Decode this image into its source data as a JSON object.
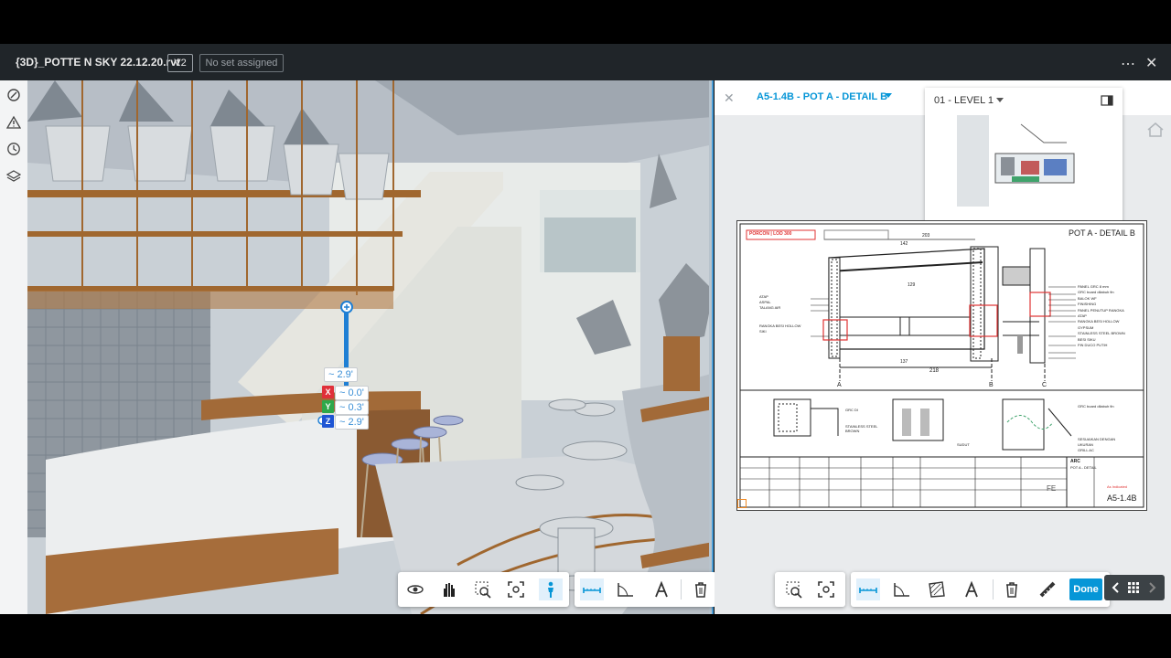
{
  "header": {
    "file_title": "{3D}_POTTE N SKY 22.12.20.rvt",
    "version": "V2",
    "set_status": "No set assigned",
    "more_icon": "⋯",
    "close_icon": "✕"
  },
  "sidebar": {
    "items": [
      {
        "icon": "markup-icon"
      },
      {
        "icon": "warning-icon"
      },
      {
        "icon": "clock-icon"
      },
      {
        "icon": "layers-icon"
      }
    ]
  },
  "viewer3d": {
    "gizmo": {
      "distance": "~ 2.9'",
      "x_label": "X",
      "x_value": "~ 0.0'",
      "y_label": "Y",
      "y_value": "~ 0.3'",
      "z_label": "Z",
      "z_value": "~ 2.9'"
    },
    "toolbar": [
      "orbit-icon",
      "pan-icon",
      "zoom-window-icon",
      "fit-icon",
      "first-person-icon",
      "measure-distance-icon",
      "measure-angle-icon",
      "measure-text-icon",
      "delete-icon"
    ]
  },
  "sheet_panel": {
    "close_icon": "✕",
    "sheet_title": "A5-1.4B - POT A - DETAIL B",
    "level_select": "01 - LEVEL 1",
    "drawing": {
      "heading": "POT A - DETAIL B",
      "red_tag": "PORCON | LOD 300",
      "grid_a": "A",
      "grid_b": "B",
      "grid_c": "C",
      "dim_overall": "218",
      "dim_137": "137",
      "dim_142": "142",
      "dim_203": "203",
      "dim_129": "129",
      "sheet_no": "A5-1.4B",
      "firm": "FE",
      "title_block_name": "POT A - DETAIL",
      "title_block_code": "ARC",
      "status_text": "As Indicated",
      "left_notes": [
        "ATAP",
        "ASPAL",
        "TALANG AIR",
        "RANGKA BESI HOLLOW",
        "SIKI"
      ],
      "right_notes": [
        "PANEL GRC 8 mm",
        "GRC board dilabuh fin",
        "BALOK WF",
        "FINISHING",
        "PANEL PENUTUP RANGKA",
        "ATAP",
        "RANGKA BESI HOLLOW",
        "GYPSUM",
        "STAINLESS STEEL BROWN",
        "BESI SIKU",
        "FIN DUCO PUTIH"
      ],
      "detail_notes": [
        "GRC DI",
        "STAINLESS STEEL BROWN",
        "SUDUT",
        "GRC board dilabuh fin",
        "SESUAIKAN DENGAN",
        "UKURAN",
        "GRILL AC"
      ]
    },
    "toolbar_done": "Done"
  },
  "colors": {
    "accent": "#0696d7",
    "header_bg": "#202529",
    "red": "#e03333"
  }
}
